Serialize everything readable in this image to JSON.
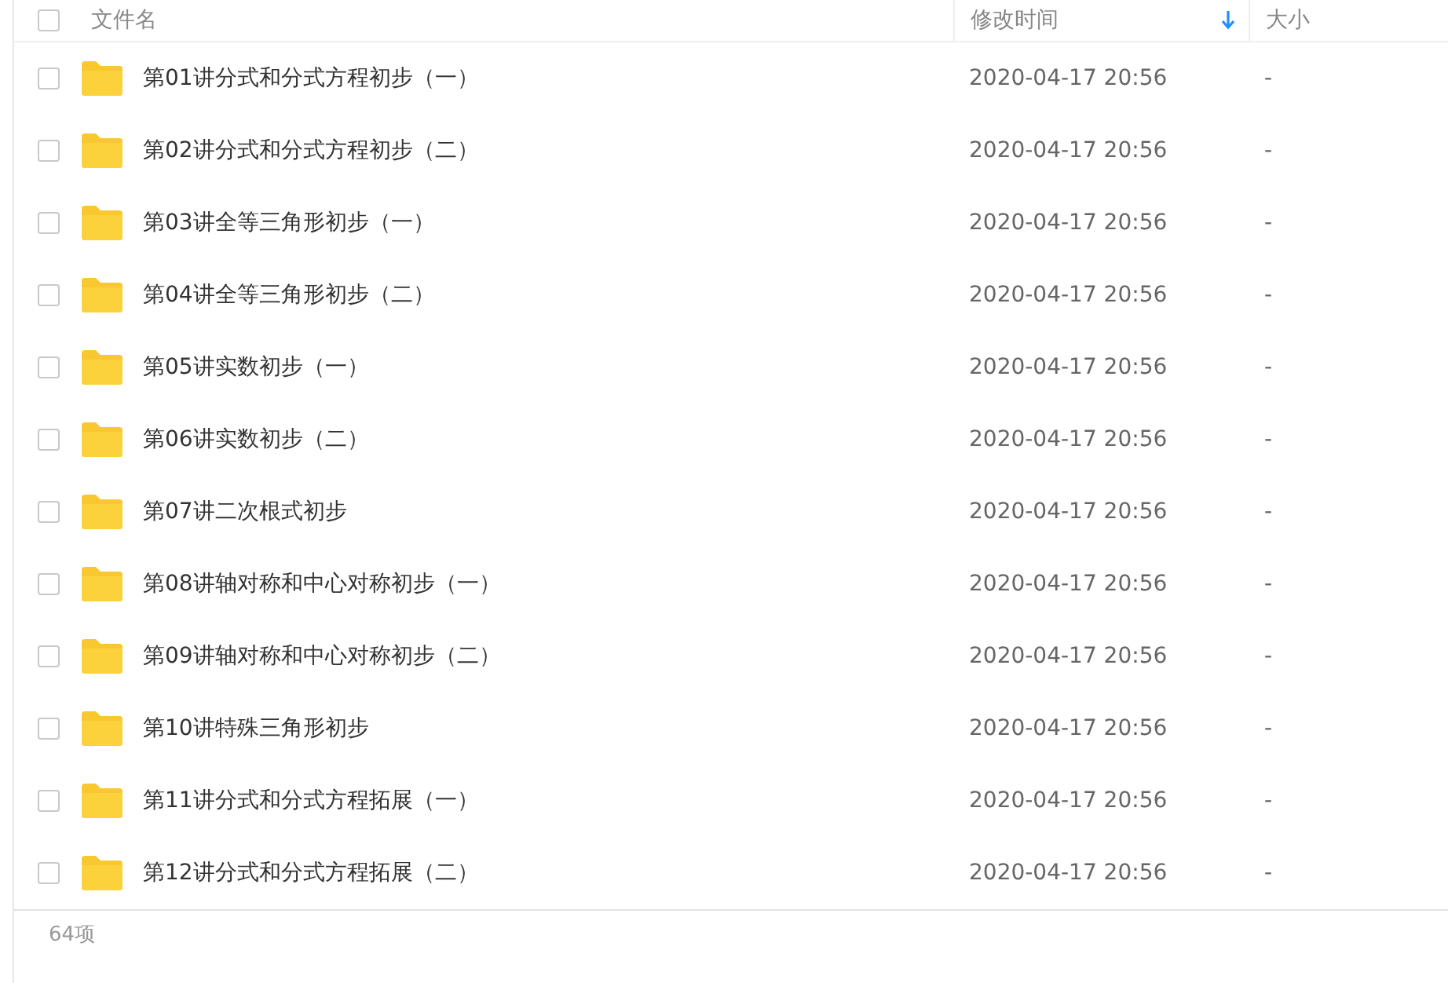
{
  "table": {
    "columns": [
      {
        "label": "文件名"
      },
      {
        "label": "修改时间",
        "sorted": true
      },
      {
        "label": "大小"
      }
    ],
    "header_checkbox": {
      "checked": false
    },
    "rows": [
      {
        "name": "第01讲分式和分式方程初步（一）",
        "modified": "2020-04-17 20:56",
        "size": "-",
        "checked": false
      },
      {
        "name": "第02讲分式和分式方程初步（二）",
        "modified": "2020-04-17 20:56",
        "size": "-",
        "checked": false
      },
      {
        "name": "第03讲全等三角形初步（一）",
        "modified": "2020-04-17 20:56",
        "size": "-",
        "checked": false
      },
      {
        "name": "第04讲全等三角形初步（二）",
        "modified": "2020-04-17 20:56",
        "size": "-",
        "checked": false
      },
      {
        "name": "第05讲实数初步（一）",
        "modified": "2020-04-17 20:56",
        "size": "-",
        "checked": false
      },
      {
        "name": "第06讲实数初步（二）",
        "modified": "2020-04-17 20:56",
        "size": "-",
        "checked": false
      },
      {
        "name": "第07讲二次根式初步",
        "modified": "2020-04-17 20:56",
        "size": "-",
        "checked": false
      },
      {
        "name": "第08讲轴对称和中心对称初步（一）",
        "modified": "2020-04-17 20:56",
        "size": "-",
        "checked": false
      },
      {
        "name": "第09讲轴对称和中心对称初步（二）",
        "modified": "2020-04-17 20:56",
        "size": "-",
        "checked": false
      },
      {
        "name": "第10讲特殊三角形初步",
        "modified": "2020-04-17 20:56",
        "size": "-",
        "checked": false
      },
      {
        "name": "第11讲分式和分式方程拓展（一）",
        "modified": "2020-04-17 20:56",
        "size": "-",
        "checked": false
      },
      {
        "name": "第12讲分式和分式方程拓展（二）",
        "modified": "2020-04-17 20:56",
        "size": "-",
        "checked": false
      }
    ]
  },
  "status_bar": {
    "count": "64项"
  }
}
